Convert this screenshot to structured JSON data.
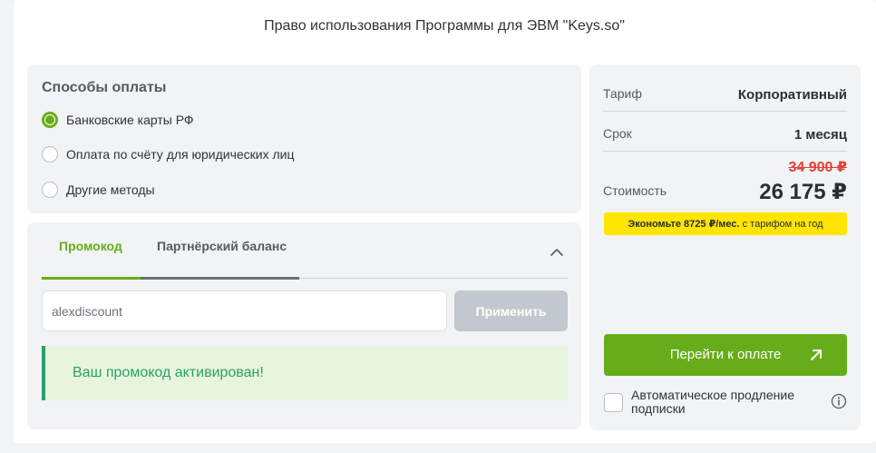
{
  "page": {
    "title": "Право использования Программы для ЭВМ \"Keys.so\""
  },
  "payment_methods": {
    "title": "Способы оплаты",
    "options": [
      {
        "label": "Банковские карты РФ",
        "selected": true
      },
      {
        "label": "Оплата по счёту для юридических лиц",
        "selected": false
      },
      {
        "label": "Другие методы",
        "selected": false
      }
    ]
  },
  "promo": {
    "tabs": [
      {
        "label": "Промокод",
        "active": true
      },
      {
        "label": "Партнёрский баланс",
        "active": false
      }
    ],
    "input_value": "alexdiscount",
    "apply_label": "Применить",
    "success_message": "Ваш промокод активирован!"
  },
  "summary": {
    "tariff_label": "Тариф",
    "tariff_value": "Корпоративный",
    "period_label": "Срок",
    "period_value": "1 месяц",
    "cost_label": "Стоимость",
    "old_price": "34 900 ₽",
    "new_price": "26 175 ₽",
    "savings_bold": "Экономьте 8725 ₽/мес.",
    "savings_rest": "с тарифом на год",
    "pay_label": "Перейти к оплате",
    "auto_renew_label": "Автоматическое продление подписки",
    "auto_renew_checked": false
  },
  "colors": {
    "accent": "#67ad19",
    "success": "#2aa06b",
    "old_price": "#e2403a",
    "badge": "#ffe500",
    "panel": "#f1f3f5"
  },
  "icons": [
    "chevron-up-icon",
    "arrow-up-right-icon",
    "info-icon"
  ]
}
